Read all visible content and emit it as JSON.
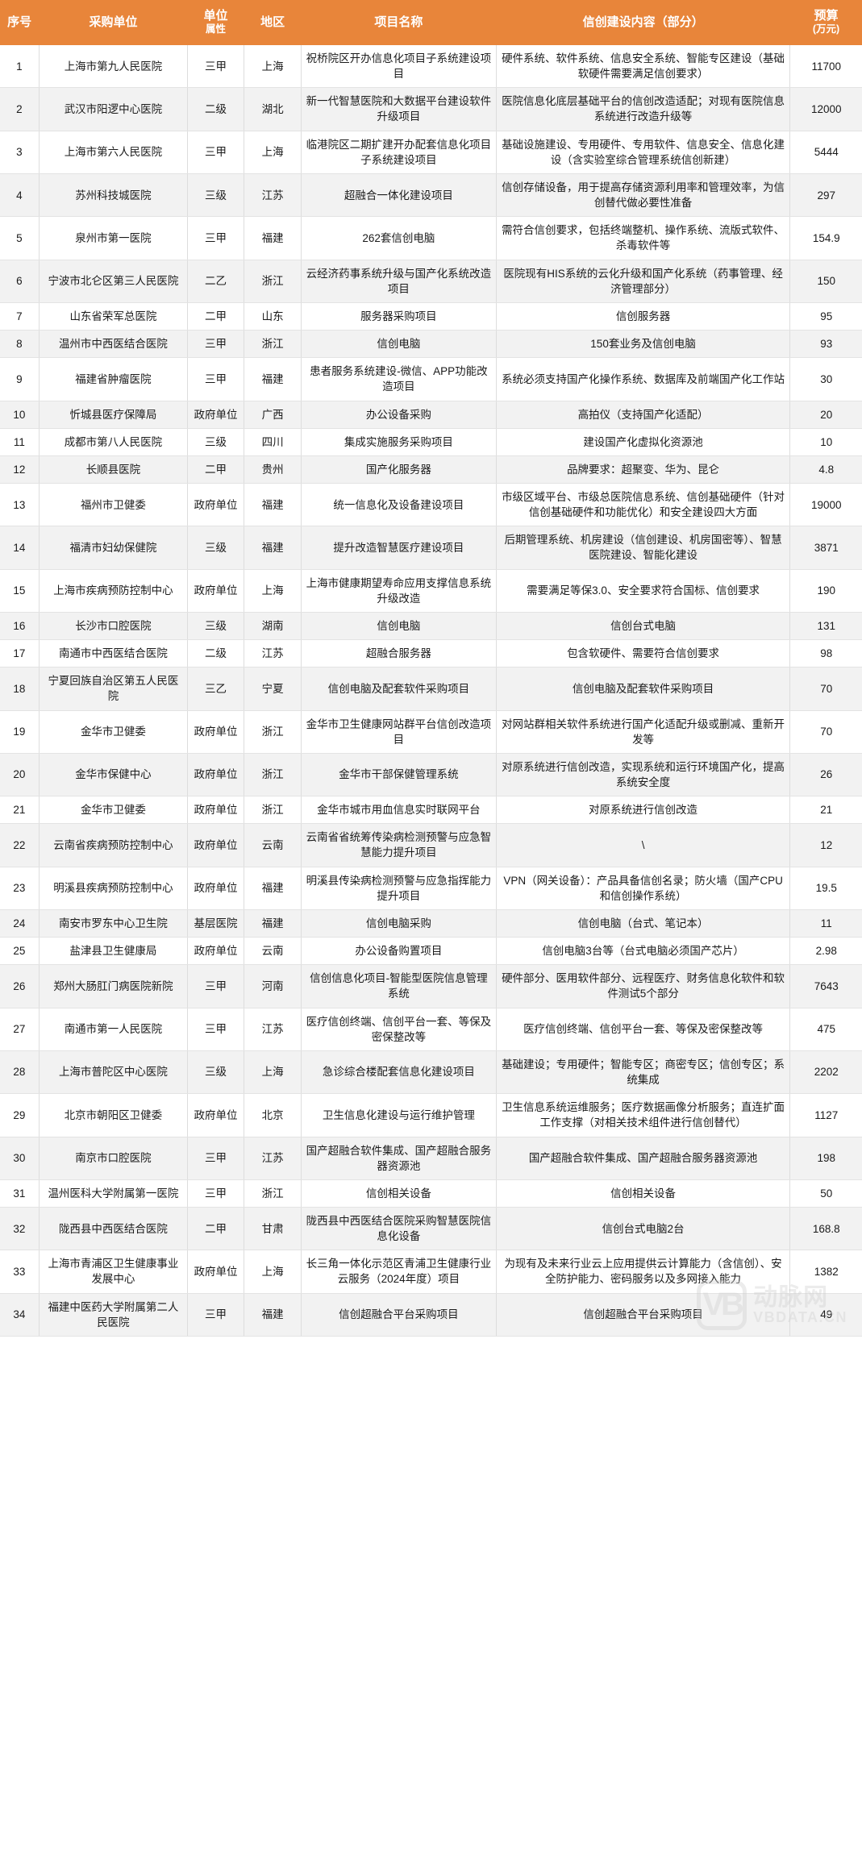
{
  "table": {
    "accent_color": "#e8853a",
    "header_text_color": "#ffffff",
    "stripe_color": "#f2f2f2",
    "columns": [
      {
        "key": "idx",
        "label": "序号",
        "sub": ""
      },
      {
        "key": "unit",
        "label": "采购单位",
        "sub": ""
      },
      {
        "key": "attr",
        "label": "单位",
        "sub": "属性"
      },
      {
        "key": "region",
        "label": "地区",
        "sub": ""
      },
      {
        "key": "project",
        "label": "项目名称",
        "sub": ""
      },
      {
        "key": "content",
        "label": "信创建设内容（部分）",
        "sub": ""
      },
      {
        "key": "budget",
        "label": "预算",
        "sub": "(万元)"
      }
    ],
    "rows": [
      {
        "idx": "1",
        "unit": "上海市第九人民医院",
        "attr": "三甲",
        "region": "上海",
        "project": "祝桥院区开办信息化项目子系统建设项目",
        "content": "硬件系统、软件系统、信息安全系统、智能专区建设（基础软硬件需要满足信创要求）",
        "budget": "11700"
      },
      {
        "idx": "2",
        "unit": "武汉市阳逻中心医院",
        "attr": "二级",
        "region": "湖北",
        "project": "新一代智慧医院和大数据平台建设软件升级项目",
        "content": "医院信息化底层基础平台的信创改造适配；对现有医院信息系统进行改造升级等",
        "budget": "12000"
      },
      {
        "idx": "3",
        "unit": "上海市第六人民医院",
        "attr": "三甲",
        "region": "上海",
        "project": "临港院区二期扩建开办配套信息化项目子系统建设项目",
        "content": "基础设施建设、专用硬件、专用软件、信息安全、信息化建设（含实验室综合管理系统信创新建）",
        "budget": "5444"
      },
      {
        "idx": "4",
        "unit": "苏州科技城医院",
        "attr": "三级",
        "region": "江苏",
        "project": "超融合一体化建设项目",
        "content": "信创存储设备，用于提高存储资源利用率和管理效率，为信创替代做必要性准备",
        "budget": "297"
      },
      {
        "idx": "5",
        "unit": "泉州市第一医院",
        "attr": "三甲",
        "region": "福建",
        "project": "262套信创电脑",
        "content": "需符合信创要求，包括终端整机、操作系统、流版式软件、杀毒软件等",
        "budget": "154.9"
      },
      {
        "idx": "6",
        "unit": "宁波市北仑区第三人民医院",
        "attr": "二乙",
        "region": "浙江",
        "project": "云经济药事系统升级与国产化系统改造项目",
        "content": "医院现有HIS系统的云化升级和国产化系统（药事管理、经济管理部分）",
        "budget": "150"
      },
      {
        "idx": "7",
        "unit": "山东省荣军总医院",
        "attr": "二甲",
        "region": "山东",
        "project": "服务器采购项目",
        "content": "信创服务器",
        "budget": "95"
      },
      {
        "idx": "8",
        "unit": "温州市中西医结合医院",
        "attr": "三甲",
        "region": "浙江",
        "project": "信创电脑",
        "content": "150套业务及信创电脑",
        "budget": "93"
      },
      {
        "idx": "9",
        "unit": "福建省肿瘤医院",
        "attr": "三甲",
        "region": "福建",
        "project": "患者服务系统建设-微信、APP功能改造项目",
        "content": "系统必须支持国产化操作系统、数据库及前端国产化工作站",
        "budget": "30"
      },
      {
        "idx": "10",
        "unit": "忻城县医疗保障局",
        "attr": "政府单位",
        "region": "广西",
        "project": "办公设备采购",
        "content": "高拍仪（支持国产化适配）",
        "budget": "20"
      },
      {
        "idx": "11",
        "unit": "成都市第八人民医院",
        "attr": "三级",
        "region": "四川",
        "project": "集成实施服务采购项目",
        "content": "建设国产化虚拟化资源池",
        "budget": "10"
      },
      {
        "idx": "12",
        "unit": "长顺县医院",
        "attr": "二甲",
        "region": "贵州",
        "project": "国产化服务器",
        "content": "品牌要求：超聚变、华为、昆仑",
        "budget": "4.8"
      },
      {
        "idx": "13",
        "unit": "福州市卫健委",
        "attr": "政府单位",
        "region": "福建",
        "project": "统一信息化及设备建设项目",
        "content": "市级区域平台、市级总医院信息系统、信创基础硬件（针对信创基础硬件和功能优化）和安全建设四大方面",
        "budget": "19000"
      },
      {
        "idx": "14",
        "unit": "福清市妇幼保健院",
        "attr": "三级",
        "region": "福建",
        "project": "提升改造智慧医疗建设项目",
        "content": "后期管理系统、机房建设（信创建设、机房国密等）、智慧医院建设、智能化建设",
        "budget": "3871"
      },
      {
        "idx": "15",
        "unit": "上海市疾病预防控制中心",
        "attr": "政府单位",
        "region": "上海",
        "project": "上海市健康期望寿命应用支撑信息系统升级改造",
        "content": "需要满足等保3.0、安全要求符合国标、信创要求",
        "budget": "190"
      },
      {
        "idx": "16",
        "unit": "长沙市口腔医院",
        "attr": "三级",
        "region": "湖南",
        "project": "信创电脑",
        "content": "信创台式电脑",
        "budget": "131"
      },
      {
        "idx": "17",
        "unit": "南通市中西医结合医院",
        "attr": "二级",
        "region": "江苏",
        "project": "超融合服务器",
        "content": "包含软硬件、需要符合信创要求",
        "budget": "98"
      },
      {
        "idx": "18",
        "unit": "宁夏回族自治区第五人民医院",
        "attr": "三乙",
        "region": "宁夏",
        "project": "信创电脑及配套软件采购项目",
        "content": "信创电脑及配套软件采购项目",
        "budget": "70"
      },
      {
        "idx": "19",
        "unit": "金华市卫健委",
        "attr": "政府单位",
        "region": "浙江",
        "project": "金华市卫生健康网站群平台信创改造项目",
        "content": "对网站群相关软件系统进行国产化适配升级或删减、重新开发等",
        "budget": "70"
      },
      {
        "idx": "20",
        "unit": "金华市保健中心",
        "attr": "政府单位",
        "region": "浙江",
        "project": "金华市干部保健管理系统",
        "content": "对原系统进行信创改造，实现系统和运行环境国产化，提高系统安全度",
        "budget": "26"
      },
      {
        "idx": "21",
        "unit": "金华市卫健委",
        "attr": "政府单位",
        "region": "浙江",
        "project": "金华市城市用血信息实时联网平台",
        "content": "对原系统进行信创改造",
        "budget": "21"
      },
      {
        "idx": "22",
        "unit": "云南省疾病预防控制中心",
        "attr": "政府单位",
        "region": "云南",
        "project": "云南省省统筹传染病检测预警与应急智慧能力提升项目",
        "content": "\\",
        "budget": "12"
      },
      {
        "idx": "23",
        "unit": "明溪县疾病预防控制中心",
        "attr": "政府单位",
        "region": "福建",
        "project": "明溪县传染病检测预警与应急指挥能力提升项目",
        "content": "VPN（网关设备）：产品具备信创名录；防火墙（国产CPU和信创操作系统）",
        "budget": "19.5"
      },
      {
        "idx": "24",
        "unit": "南安市罗东中心卫生院",
        "attr": "基层医院",
        "region": "福建",
        "project": "信创电脑采购",
        "content": "信创电脑（台式、笔记本）",
        "budget": "11"
      },
      {
        "idx": "25",
        "unit": "盐津县卫生健康局",
        "attr": "政府单位",
        "region": "云南",
        "project": "办公设备购置项目",
        "content": "信创电脑3台等（台式电脑必须国产芯片）",
        "budget": "2.98"
      },
      {
        "idx": "26",
        "unit": "郑州大肠肛门病医院新院",
        "attr": "三甲",
        "region": "河南",
        "project": "信创信息化项目-智能型医院信息管理系统",
        "content": "硬件部分、医用软件部分、远程医疗、财务信息化软件和软件测试5个部分",
        "budget": "7643"
      },
      {
        "idx": "27",
        "unit": "南通市第一人民医院",
        "attr": "三甲",
        "region": "江苏",
        "project": "医疗信创终端、信创平台一套、等保及密保整改等",
        "content": "医疗信创终端、信创平台一套、等保及密保整改等",
        "budget": "475"
      },
      {
        "idx": "28",
        "unit": "上海市普陀区中心医院",
        "attr": "三级",
        "region": "上海",
        "project": "急诊综合楼配套信息化建设项目",
        "content": "基础建设；专用硬件；智能专区；商密专区；信创专区；系统集成",
        "budget": "2202"
      },
      {
        "idx": "29",
        "unit": "北京市朝阳区卫健委",
        "attr": "政府单位",
        "region": "北京",
        "project": "卫生信息化建设与运行维护管理",
        "content": "卫生信息系统运维服务；医疗数据画像分析服务；直连扩面工作支撑（对相关技术组件进行信创替代）",
        "budget": "1127"
      },
      {
        "idx": "30",
        "unit": "南京市口腔医院",
        "attr": "三甲",
        "region": "江苏",
        "project": "国产超融合软件集成、国产超融合服务器资源池",
        "content": "国产超融合软件集成、国产超融合服务器资源池",
        "budget": "198"
      },
      {
        "idx": "31",
        "unit": "温州医科大学附属第一医院",
        "attr": "三甲",
        "region": "浙江",
        "project": "信创相关设备",
        "content": "信创相关设备",
        "budget": "50"
      },
      {
        "idx": "32",
        "unit": "陇西县中西医结合医院",
        "attr": "二甲",
        "region": "甘肃",
        "project": "陇西县中西医结合医院采购智慧医院信息化设备",
        "content": "信创台式电脑2台",
        "budget": "168.8"
      },
      {
        "idx": "33",
        "unit": "上海市青浦区卫生健康事业发展中心",
        "attr": "政府单位",
        "region": "上海",
        "project": "长三角一体化示范区青浦卫生健康行业云服务（2024年度）项目",
        "content": "为现有及未来行业云上应用提供云计算能力（含信创）、安全防护能力、密码服务以及多网接入能力",
        "budget": "1382"
      },
      {
        "idx": "34",
        "unit": "福建中医药大学附属第二人民医院",
        "attr": "三甲",
        "region": "福建",
        "project": "信创超融合平台采购项目",
        "content": "信创超融合平台采购项目",
        "budget": "49"
      }
    ]
  },
  "watermark": {
    "logo_text": "VB",
    "cn_text": "动脉网",
    "en_text": "VBDATA.CN"
  }
}
